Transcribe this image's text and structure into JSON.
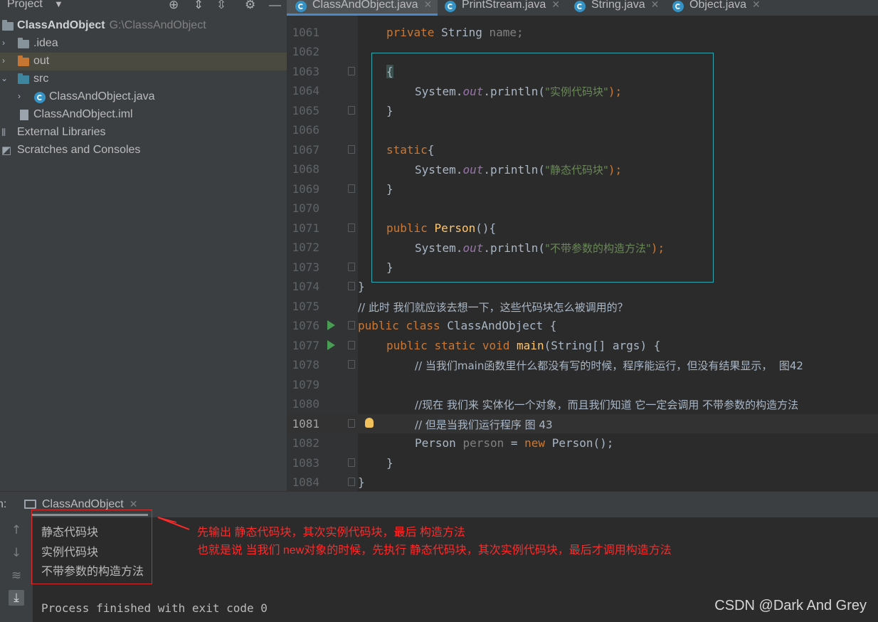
{
  "project_panel": {
    "title": "Project",
    "tree": [
      {
        "label": "ClassAndObject",
        "path": "G:\\ClassAndObject",
        "icon": "folder-icon"
      },
      {
        "label": ".idea",
        "icon": "folder-icon"
      },
      {
        "label": "out",
        "icon": "folder-icon"
      },
      {
        "label": "src",
        "icon": "folder-icon"
      },
      {
        "label": "ClassAndObject.java",
        "icon": "java-class-icon"
      },
      {
        "label": "ClassAndObject.iml",
        "icon": "file-icon"
      },
      {
        "label": "External Libraries",
        "icon": "library-icon"
      },
      {
        "label": "Scratches and Consoles",
        "icon": "scratches-icon"
      }
    ]
  },
  "tabs": [
    {
      "label": "ClassAndObject.java",
      "active": true
    },
    {
      "label": "PrintStream.java",
      "active": false
    },
    {
      "label": "String.java",
      "active": false
    },
    {
      "label": "Object.java",
      "active": false
    }
  ],
  "editor": {
    "current_line": "1081",
    "lines": [
      {
        "num": "1061",
        "t": [
          "private",
          "String",
          "name;"
        ]
      },
      {
        "num": "1062"
      },
      {
        "num": "1063",
        "t": [
          "{"
        ]
      },
      {
        "num": "1064",
        "t": [
          "System.",
          "out",
          ".println(",
          "\"实例代码块\"",
          ");"
        ]
      },
      {
        "num": "1065",
        "t": [
          "}"
        ]
      },
      {
        "num": "1066"
      },
      {
        "num": "1067",
        "t": [
          "static",
          "{"
        ]
      },
      {
        "num": "1068",
        "t": [
          "System.",
          "out",
          ".println(",
          "\"静态代码块\"",
          ");"
        ]
      },
      {
        "num": "1069",
        "t": [
          "}"
        ]
      },
      {
        "num": "1070"
      },
      {
        "num": "1071",
        "t": [
          "public",
          "Person",
          "(){"
        ]
      },
      {
        "num": "1072",
        "t": [
          "System.",
          "out",
          ".println(",
          "\"不带参数的构造方法\"",
          ");"
        ]
      },
      {
        "num": "1073",
        "t": [
          "}"
        ]
      },
      {
        "num": "1074",
        "t": [
          "}"
        ]
      },
      {
        "num": "1075",
        "t": [
          "// 此时 我们就应该去想一下，这些代码块怎么被调用的？"
        ]
      },
      {
        "num": "1076",
        "t": [
          "public",
          "class",
          "ClassAndObject {"
        ]
      },
      {
        "num": "1077",
        "t": [
          "public",
          "static",
          "void",
          "main",
          "(String[] args) {"
        ]
      },
      {
        "num": "1078",
        "t": [
          "// 当我们main函数里什么都没有写的时候，程序能运行，但没有结果显示，  图42"
        ]
      },
      {
        "num": "1079"
      },
      {
        "num": "1080",
        "t": [
          "//现在 我们来 实体化一个对象，而且我们知道 它一定会调用 不带参数的构造方法"
        ]
      },
      {
        "num": "1081",
        "t": [
          "// 但是当我们运行程序 图 43"
        ]
      },
      {
        "num": "1082",
        "t": [
          "Person",
          "person",
          "=",
          "new",
          "Person();"
        ]
      },
      {
        "num": "1083",
        "t": [
          "}"
        ]
      },
      {
        "num": "1084",
        "t": [
          "}"
        ]
      }
    ]
  },
  "run_panel": {
    "label": "n:",
    "tab_label": "ClassAndObject",
    "output": [
      "静态代码块",
      "实例代码块",
      "不带参数的构造方法"
    ],
    "exit_message": "Process finished with exit code 0",
    "annotation": [
      "先输出 静态代码块，其次实例代码块，最后 构造方法",
      "也就是说 当我们 new对象的时候，先执行 静态代码块，其次实例代码块，最后才调用构造方法"
    ],
    "watermark": "CSDN @Dark And Grey"
  },
  "colors": {
    "keyword": "#cc7832",
    "string": "#6a8759",
    "comment": "#808080",
    "static_field": "#9876aa",
    "method_decl": "#ffc66d",
    "annotation_red": "#ff2a2a",
    "highlight_box": "#2ea7b0"
  }
}
